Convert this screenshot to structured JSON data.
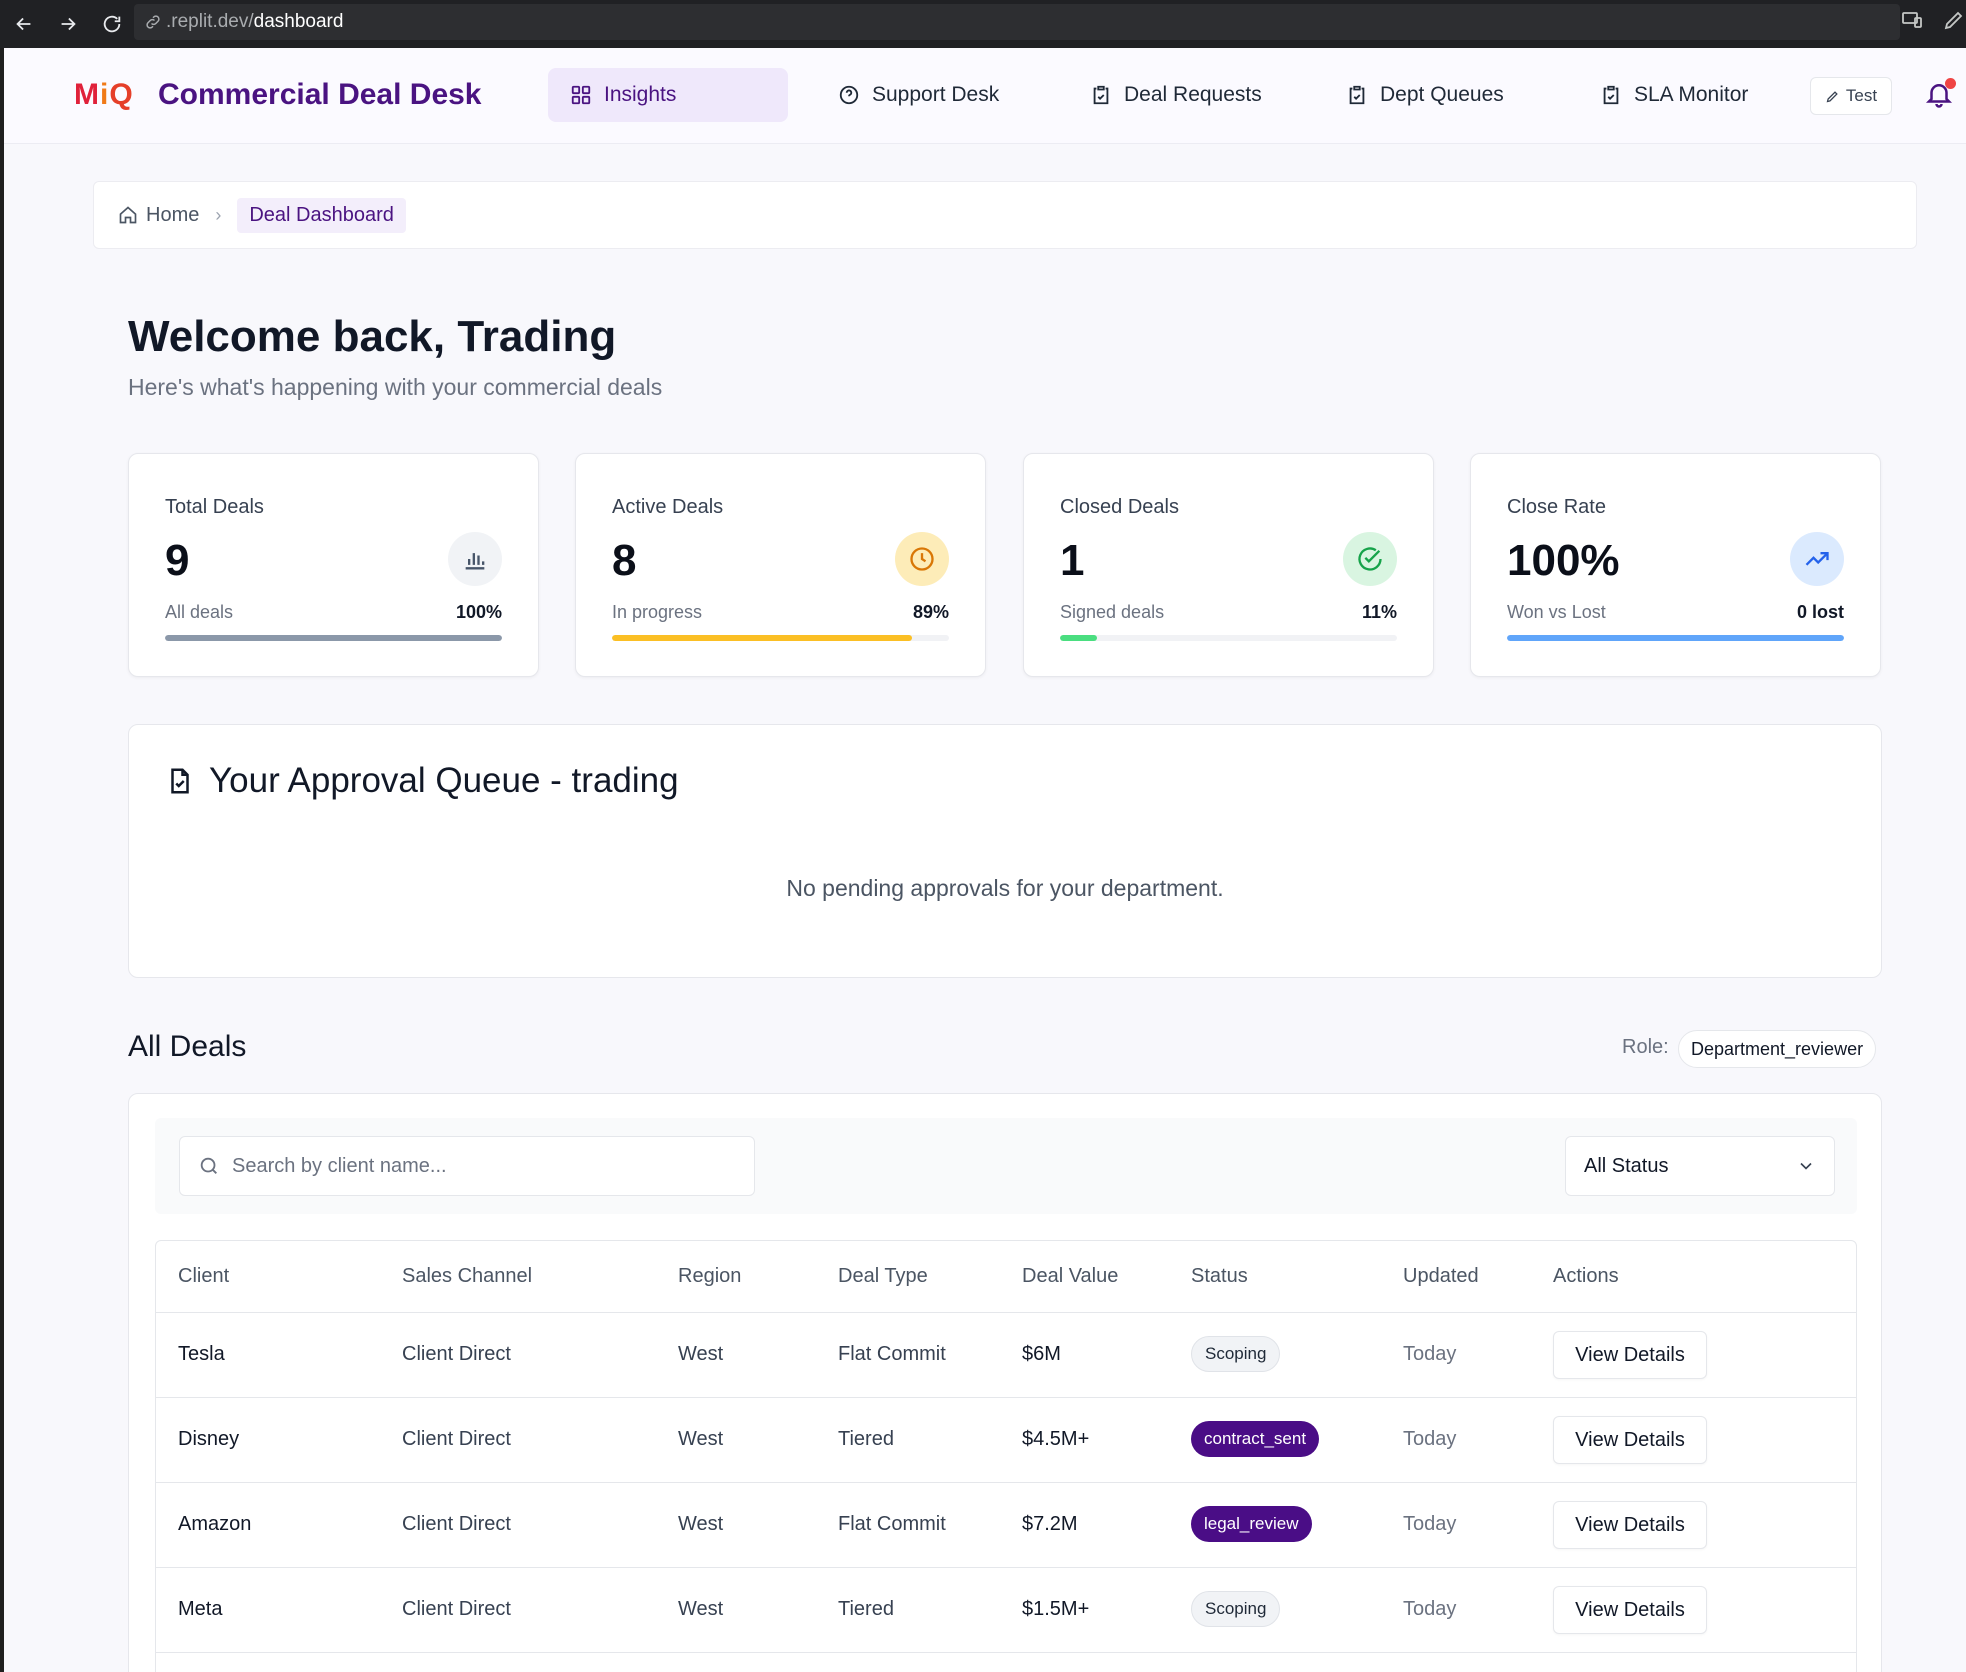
{
  "browser": {
    "url_prefix": ".replit.dev/",
    "url_path": "dashboard"
  },
  "nav": {
    "logo": {
      "m": "M",
      "i": "i",
      "q": "Q"
    },
    "app_title": "Commercial Deal Desk",
    "items": [
      {
        "label": "Insights",
        "icon": "grid-icon",
        "active": true
      },
      {
        "label": "Support Desk",
        "icon": "help-circle-icon",
        "active": false
      },
      {
        "label": "Deal Requests",
        "icon": "clipboard-icon",
        "active": false
      },
      {
        "label": "Dept Queues",
        "icon": "clipboard-icon",
        "active": false
      },
      {
        "label": "SLA Monitor",
        "icon": "clipboard-icon",
        "active": false
      }
    ],
    "test_label": "Test"
  },
  "breadcrumb": {
    "home": "Home",
    "current": "Deal Dashboard"
  },
  "welcome": {
    "title": "Welcome back, Trading",
    "subtitle": "Here's what's happening with your commercial deals"
  },
  "stats": [
    {
      "label": "Total Deals",
      "value": "9",
      "sub": "All deals",
      "pct": "100%",
      "fill": 1.0,
      "color": "#8b98a9",
      "icon_bg": "#f1f3f6",
      "icon": "bar-chart-icon"
    },
    {
      "label": "Active Deals",
      "value": "8",
      "sub": "In progress",
      "pct": "89%",
      "fill": 0.89,
      "color": "#fbbf24",
      "icon_bg": "#fdecb8",
      "icon": "clock-icon"
    },
    {
      "label": "Closed Deals",
      "value": "1",
      "sub": "Signed deals",
      "pct": "11%",
      "fill": 0.11,
      "color": "#4ade80",
      "icon_bg": "#d9f5e1",
      "icon": "check-circle-icon"
    },
    {
      "label": "Close Rate",
      "value": "100%",
      "sub": "Won vs Lost",
      "pct": "0 lost",
      "fill": 1.0,
      "color": "#60a5fa",
      "icon_bg": "#dbeafe",
      "icon": "trending-up-icon"
    }
  ],
  "approval": {
    "title": "Your Approval Queue - trading",
    "empty": "No pending approvals for your department."
  },
  "deals": {
    "title": "All Deals",
    "role_label": "Role:",
    "role": "Department_reviewer",
    "search_placeholder": "Search by client name...",
    "status_filter": "All Status",
    "columns": [
      "Client",
      "Sales Channel",
      "Region",
      "Deal Type",
      "Deal Value",
      "Status",
      "Updated",
      "Actions"
    ],
    "rows": [
      {
        "client": "Tesla",
        "channel": "Client Direct",
        "region": "West",
        "type": "Flat Commit",
        "value": "$6M",
        "status": "Scoping",
        "status_style": "scoping",
        "updated": "Today",
        "action": "View Details"
      },
      {
        "client": "Disney",
        "channel": "Client Direct",
        "region": "West",
        "type": "Tiered",
        "value": "$4.5M+",
        "status": "contract_sent",
        "status_style": "dark",
        "updated": "Today",
        "action": "View Details"
      },
      {
        "client": "Amazon",
        "channel": "Client Direct",
        "region": "West",
        "type": "Flat Commit",
        "value": "$7.2M",
        "status": "legal_review",
        "status_style": "dark",
        "updated": "Today",
        "action": "View Details"
      },
      {
        "client": "Meta",
        "channel": "Client Direct",
        "region": "West",
        "type": "Tiered",
        "value": "$1.5M+",
        "status": "Scoping",
        "status_style": "scoping",
        "updated": "Today",
        "action": "View Details"
      }
    ]
  }
}
